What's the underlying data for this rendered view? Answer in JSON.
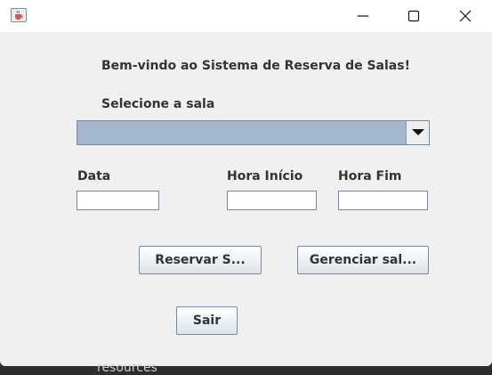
{
  "window": {
    "icons": {
      "app": "java-cup-icon",
      "minimize": "minimize-icon",
      "maximize": "maximize-icon",
      "close": "close-icon"
    }
  },
  "form": {
    "welcome": "Bem-vindo ao Sistema de Reserva de Salas!",
    "select_label": "Selecione a sala",
    "room_select": {
      "selected": ""
    },
    "date_label": "Data",
    "start_label": "Hora Início",
    "end_label": "Hora Fim",
    "date_value": "",
    "start_value": "",
    "end_value": ""
  },
  "buttons": {
    "reserve": "Reservar S...",
    "manage": "Gerenciar sal...",
    "exit": "Sair"
  },
  "background": {
    "text": "resources"
  },
  "colors": {
    "combo_fill": "#a3b8cc",
    "window_bg": "#f0f0f0",
    "border": "#7a8a9c"
  }
}
